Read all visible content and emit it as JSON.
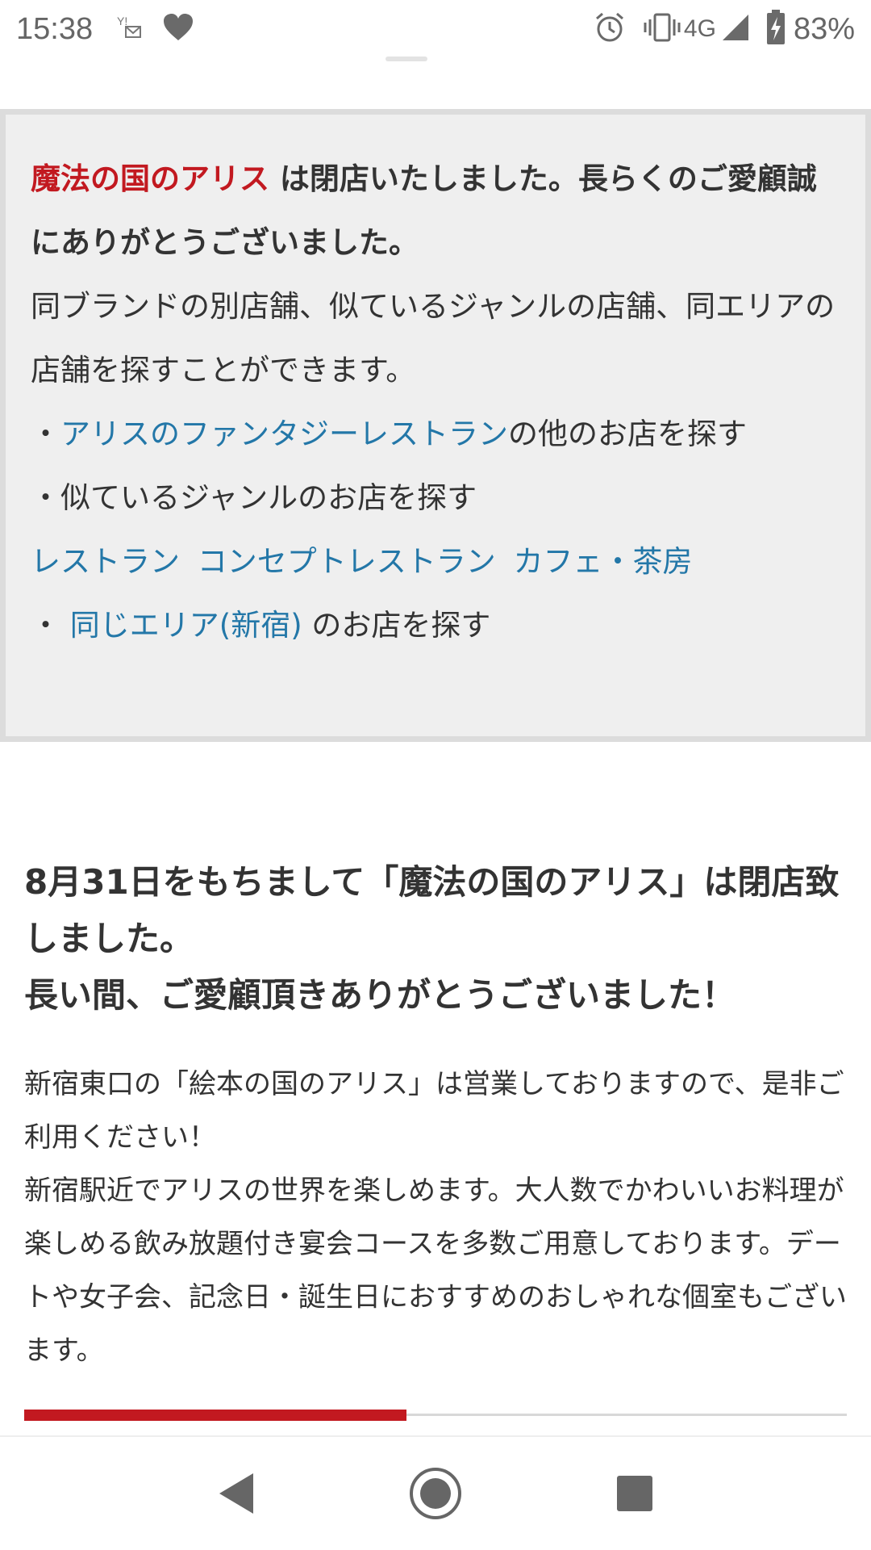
{
  "status_bar": {
    "time": "15:38",
    "network": "4G",
    "battery": "83%",
    "icons": [
      "mail-notification-icon",
      "heart-icon",
      "alarm-icon",
      "vibrate-icon",
      "signal-icon",
      "battery-charging-icon"
    ]
  },
  "notice": {
    "shop_name": "魔法の国のアリス",
    "closed_message": " は閉店いたしました。長らくのご愛顧誠にありがとうございました。",
    "search_intro": "同ブランドの別店舗、似ているジャンルの店舗、同エリアの店舗を探すことができます。",
    "brand_bullet": "・",
    "brand_link": "アリスのファンタジーレストラン",
    "brand_suffix": "の他のお店を探す",
    "genre_line": "・似ているジャンルのお店を探す",
    "genre_links": [
      "レストラン",
      "コンセプトレストラン",
      "カフェ・茶房"
    ],
    "area_bullet": "・",
    "area_link": "同じエリア(新宿)",
    "area_suffix": " のお店を探す"
  },
  "main": {
    "heading_line1": "8月31日をもちまして「魔法の国のアリス」は閉店致しました。",
    "heading_line2": "長い間、ご愛顧頂きありがとうございました！",
    "body_line1": "新宿東口の「絵本の国のアリス」は営業しておりますので、是非ご利用ください！",
    "body_line2": "新宿駅近でアリスの世界を楽しめます。大人数でかわいいお料理が楽しめる飲み放題付き宴会コースを多数ご用意しております。デートや女子会、記念日・誕生日におすすめのおしゃれな個室もございます。"
  },
  "progress": {
    "fraction": 0.465
  },
  "colors": {
    "accent_red": "#c21920",
    "link_blue": "#2377a8"
  }
}
